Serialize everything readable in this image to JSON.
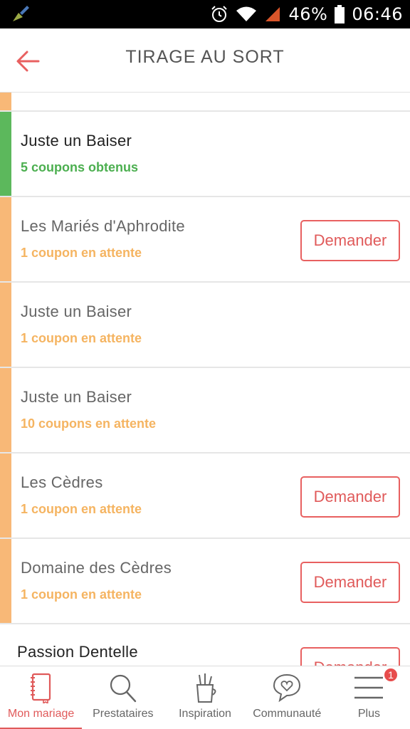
{
  "status_bar": {
    "battery": "46%",
    "time": "06:46",
    "icons": [
      "brush-icon",
      "alarm-icon",
      "wifi-icon",
      "signal-icon",
      "battery-icon"
    ]
  },
  "header": {
    "title": "TIRAGE AU SORT",
    "back_icon": "back-arrow-icon"
  },
  "colors": {
    "accent_green": "#5cb85c",
    "accent_orange": "#f8b877",
    "status_green": "#4caf50",
    "status_orange": "#f5b461",
    "brand_red": "#e05a5a"
  },
  "list": {
    "items": [
      {
        "name": "Juste un Baiser",
        "status": "5 coupons obtenus",
        "state": "obtained"
      },
      {
        "name": "Les Mariés d'Aphrodite",
        "status": "1 coupon en attente",
        "state": "pending",
        "button": "Demander"
      },
      {
        "name": "Juste un Baiser",
        "status": "1 coupon en attente",
        "state": "pending"
      },
      {
        "name": "Juste un Baiser",
        "status": "10 coupons en attente",
        "state": "pending"
      },
      {
        "name": "Les Cèdres",
        "status": "1 coupon en attente",
        "state": "pending",
        "button": "Demander"
      },
      {
        "name": "Domaine des Cèdres",
        "status": "1 coupon en attente",
        "state": "pending",
        "button": "Demander"
      },
      {
        "name": "Passion Dentelle",
        "button": "Demander"
      }
    ]
  },
  "bottom_nav": {
    "items": [
      {
        "label": "Mon mariage",
        "icon": "notebook-icon",
        "active": true
      },
      {
        "label": "Prestataires",
        "icon": "search-icon"
      },
      {
        "label": "Inspiration",
        "icon": "pencil-cup-icon"
      },
      {
        "label": "Communauté",
        "icon": "heart-chat-icon"
      },
      {
        "label": "Plus",
        "icon": "menu-icon",
        "badge": "1"
      }
    ]
  }
}
